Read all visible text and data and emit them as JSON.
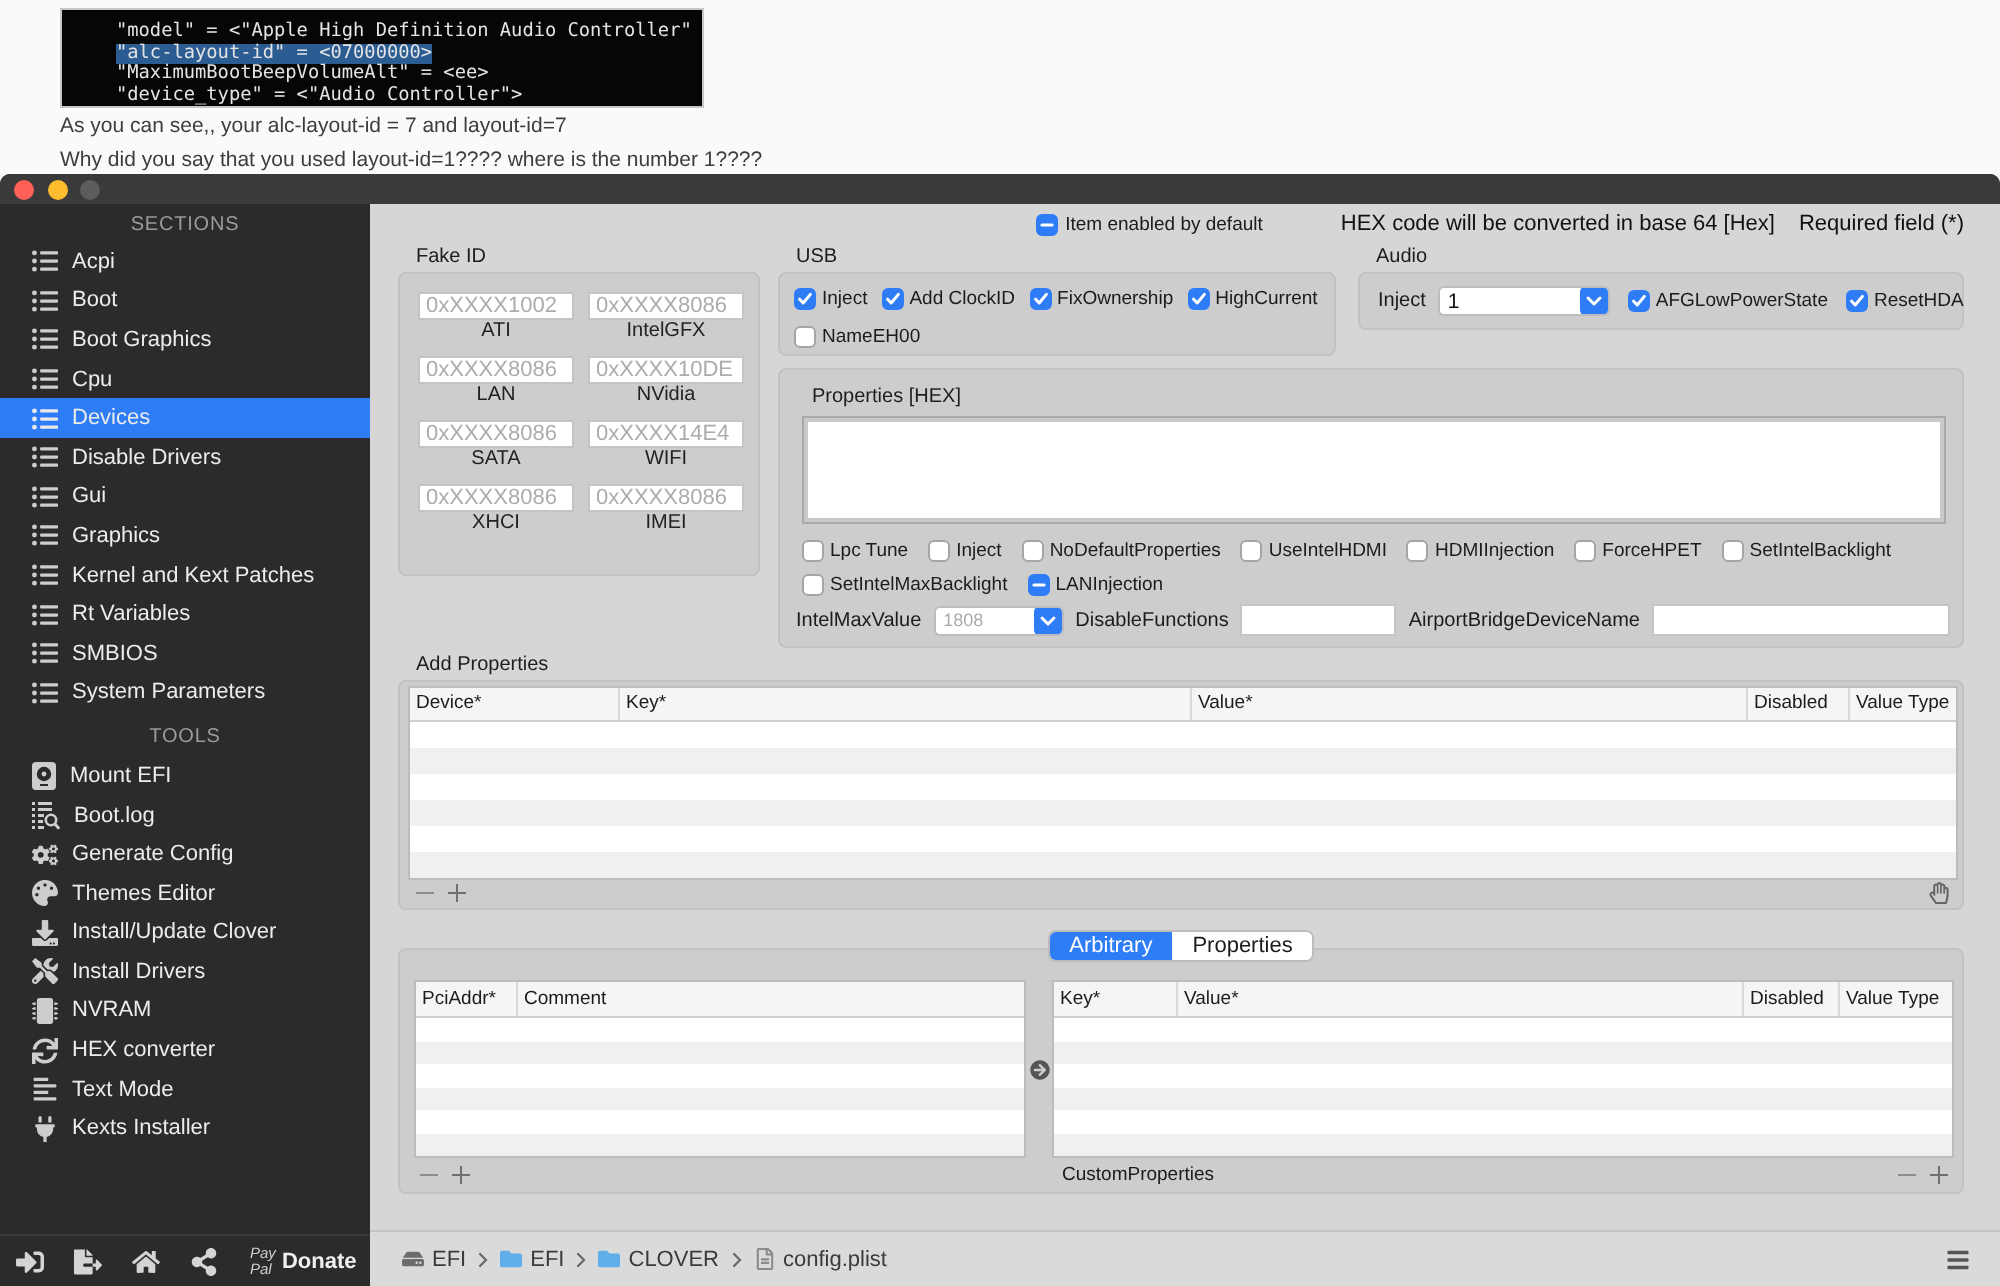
{
  "post": {
    "terminal_lines": [
      {
        "text": "\"model\" = <\"Apple High Definition Audio Controller\"",
        "selected": false
      },
      {
        "text": "\"alc-layout-id\" = <07000000>",
        "selected": true
      },
      {
        "text": "\"MaximumBootBeepVolumeAlt\" = <ee>",
        "selected": false
      },
      {
        "text": "\"device_type\" = <\"Audio Controller\">",
        "selected": false
      }
    ],
    "paragraphs": [
      "As you can see,, your alc-layout-id = 7 and layout-id=7",
      "Why did you say that you used layout-id=1???? where is the number 1????"
    ]
  },
  "sidebar": {
    "sections_title": "SECTIONS",
    "sections": [
      {
        "label": "Acpi",
        "selected": false
      },
      {
        "label": "Boot",
        "selected": false
      },
      {
        "label": "Boot Graphics",
        "selected": false
      },
      {
        "label": "Cpu",
        "selected": false
      },
      {
        "label": "Devices",
        "selected": true
      },
      {
        "label": "Disable Drivers",
        "selected": false
      },
      {
        "label": "Gui",
        "selected": false
      },
      {
        "label": "Graphics",
        "selected": false
      },
      {
        "label": "Kernel and Kext Patches",
        "selected": false
      },
      {
        "label": "Rt Variables",
        "selected": false
      },
      {
        "label": "SMBIOS",
        "selected": false
      },
      {
        "label": "System Parameters",
        "selected": false
      }
    ],
    "tools_title": "TOOLS",
    "tools": [
      "Mount EFI",
      "Boot.log",
      "Generate Config",
      "Themes Editor",
      "Install/Update Clover",
      "Install Drivers",
      "NVRAM",
      "HEX converter",
      "Text Mode",
      "Kexts Installer"
    ],
    "donate": {
      "logo": [
        "Pay",
        "Pal"
      ],
      "label": "Donate"
    }
  },
  "header": {
    "default_toggle": {
      "label": "Item enabled by default",
      "checked": true,
      "mixed": true
    },
    "hex_note": "HEX code will be converted in base 64 [Hex]",
    "required_note": "Required field (*)"
  },
  "fake_id": {
    "title": "Fake ID",
    "fields": [
      {
        "label": "ATI",
        "placeholder": "0xXXXX1002"
      },
      {
        "label": "IntelGFX",
        "placeholder": "0xXXXX8086"
      },
      {
        "label": "LAN",
        "placeholder": "0xXXXX8086"
      },
      {
        "label": "NVidia",
        "placeholder": "0xXXXX10DE"
      },
      {
        "label": "SATA",
        "placeholder": "0xXXXX8086"
      },
      {
        "label": "WIFI",
        "placeholder": "0xXXXX14E4"
      },
      {
        "label": "XHCI",
        "placeholder": "0xXXXX8086"
      },
      {
        "label": "IMEI",
        "placeholder": "0xXXXX8086"
      }
    ]
  },
  "usb": {
    "title": "USB",
    "options": [
      {
        "label": "Inject",
        "checked": true,
        "mixed": false
      },
      {
        "label": "Add ClockID",
        "checked": true,
        "mixed": false
      },
      {
        "label": "FixOwnership",
        "checked": true,
        "mixed": false
      },
      {
        "label": "HighCurrent",
        "checked": true,
        "mixed": false
      },
      {
        "label": "NameEH00",
        "checked": false,
        "mixed": false
      }
    ]
  },
  "audio": {
    "title": "Audio",
    "inject_label": "Inject",
    "inject_value": "1",
    "options": [
      {
        "label": "AFGLowPowerState",
        "checked": true,
        "mixed": false
      },
      {
        "label": "ResetHDA",
        "checked": true,
        "mixed": false
      }
    ]
  },
  "properties": {
    "title": "Properties [HEX]",
    "options": [
      {
        "label": "Lpc Tune",
        "checked": false,
        "mixed": false
      },
      {
        "label": "Inject",
        "checked": false,
        "mixed": false
      },
      {
        "label": "NoDefaultProperties",
        "checked": false,
        "mixed": false
      },
      {
        "label": "UseIntelHDMI",
        "checked": false,
        "mixed": false
      },
      {
        "label": "HDMIInjection",
        "checked": false,
        "mixed": false
      },
      {
        "label": "ForceHPET",
        "checked": false,
        "mixed": false
      },
      {
        "label": "SetIntelBacklight",
        "checked": false,
        "mixed": false
      },
      {
        "label": "SetIntelMaxBacklight",
        "checked": false,
        "mixed": false
      },
      {
        "label": "LANInjection",
        "checked": true,
        "mixed": true
      }
    ],
    "intel_max_value": {
      "label": "IntelMaxValue",
      "value": "1808",
      "disabled": true
    },
    "disable_functions_label": "DisableFunctions",
    "airport_bridge_label": "AirportBridgeDeviceName"
  },
  "add_properties": {
    "title": "Add Properties",
    "columns": [
      "Device*",
      "Key*",
      "Value*",
      "Disabled",
      "Value Type"
    ]
  },
  "custom_properties": {
    "tabs": [
      {
        "label": "Arbitrary",
        "selected": true
      },
      {
        "label": "Properties",
        "selected": false
      }
    ],
    "left_columns": [
      "PciAddr*",
      "Comment"
    ],
    "right_columns": [
      "Key*",
      "Value*",
      "Disabled",
      "Value Type"
    ],
    "caption": "CustomProperties"
  },
  "status_bar": {
    "path": [
      {
        "label": "EFI",
        "kind": "drive"
      },
      {
        "label": "EFI",
        "kind": "folder"
      },
      {
        "label": "CLOVER",
        "kind": "folder"
      },
      {
        "label": "config.plist",
        "kind": "file"
      }
    ]
  }
}
